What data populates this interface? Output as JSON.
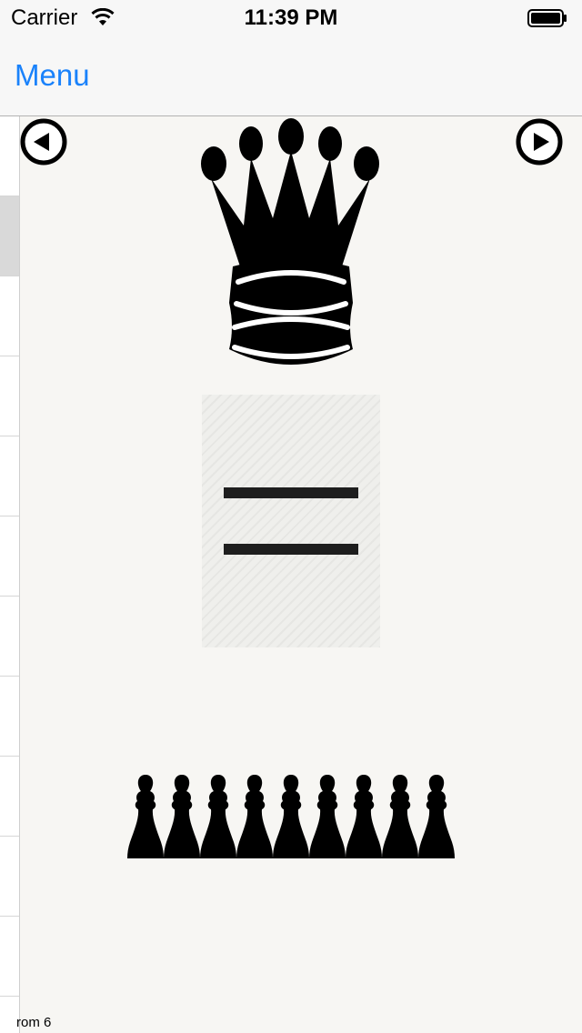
{
  "status_bar": {
    "carrier": "Carrier",
    "time": "11:39 PM"
  },
  "nav": {
    "menu_label": "Menu"
  },
  "side_list": {
    "row_count": 11,
    "selected_index": 1
  },
  "content": {
    "queen_icon": "queen-icon",
    "equals_icon": "equals-icon",
    "pawn_count": 9
  },
  "footer": {
    "text": "rom 6"
  }
}
